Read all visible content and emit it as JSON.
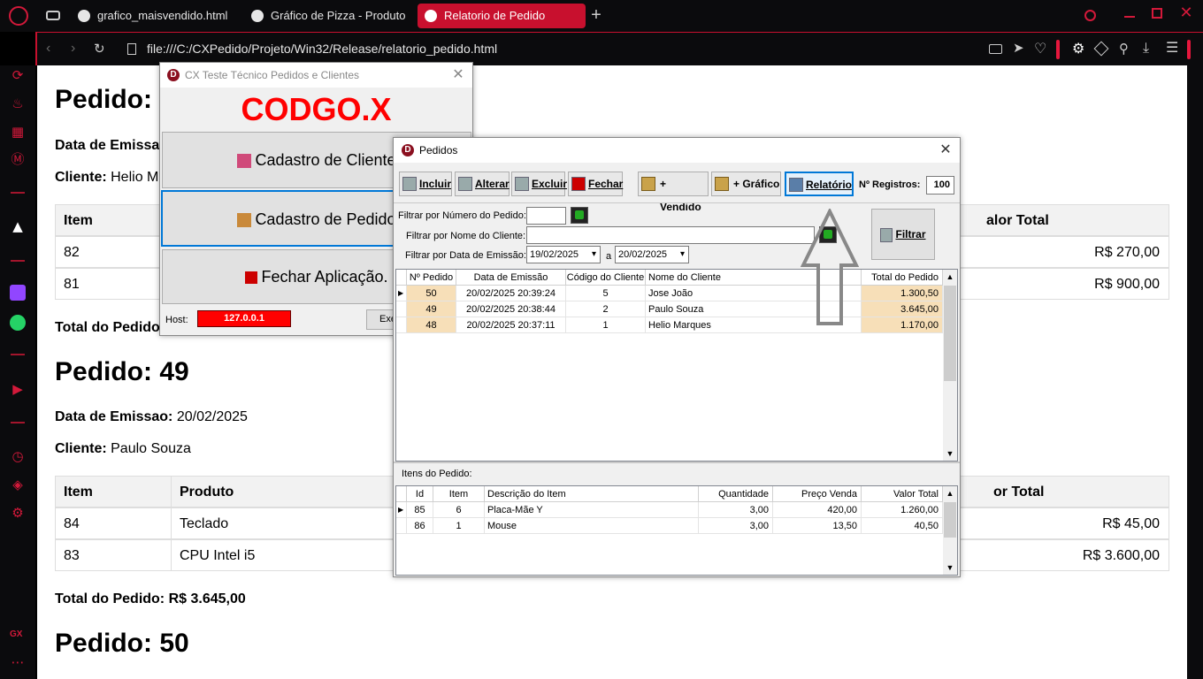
{
  "browser": {
    "tabs": [
      {
        "label": "grafico_maisvendido.html"
      },
      {
        "label": "Gráfico de Pizza - Produto"
      },
      {
        "label": "Relatorio de Pedido"
      }
    ],
    "url": "file:///C:/CXPedido/Projeto/Win32/Release/relatorio_pedido.html",
    "accent": "#c8102e",
    "sidebar_footer": "GX"
  },
  "report": {
    "order1": {
      "title": "Pedido:",
      "date_label": "Data de Emissa",
      "client_label": "Cliente:",
      "client_value": "Helio Ma",
      "col_item": "Item",
      "col_total_partial": "alor Total",
      "rows": [
        {
          "item": "82",
          "total": "R$ 270,00"
        },
        {
          "item": "81",
          "total": "R$ 900,00"
        }
      ],
      "total_label": "Total do Pedido"
    },
    "order2": {
      "title": "Pedido: 49",
      "date_label": "Data de Emissao:",
      "date_value": "20/02/2025",
      "client_label": "Cliente:",
      "client_value": "Paulo Souza",
      "col_item": "Item",
      "col_produto": "Produto",
      "col_total_partial": "or Total",
      "rows": [
        {
          "item": "84",
          "produto": "Teclado",
          "total": "R$ 45,00"
        },
        {
          "item": "83",
          "produto": "CPU Intel i5",
          "total": "R$ 3.600,00"
        }
      ],
      "total_label": "Total do Pedido:",
      "total_value": "R$ 3.645,00"
    },
    "order3": {
      "title": "Pedido: 50"
    }
  },
  "main_window": {
    "title": "CX Teste Técnico Pedidos e Clientes",
    "logo_text": "CODGO.X",
    "btn_clientes": "Cadastro de Cliente",
    "btn_pedidos": "Cadastro de Pedido",
    "btn_fechar": "Fechar Aplicação.",
    "host_label": "Host:",
    "host_value": "127.0.0.1",
    "btn_partial": "Exe"
  },
  "pedidos_window": {
    "title": "Pedidos",
    "toolbar": {
      "incluir": "Incluir",
      "alterar": "Alterar",
      "excluir": "Excluir",
      "fechar": "Fechar",
      "vendido": "+ Vendido",
      "grafico": "+ Gráfico",
      "relatorio": "Relatório",
      "registros_label": "Nº Registros:",
      "registros_value": "100"
    },
    "filters": {
      "numero_label": "Filtrar por Número do Pedido:",
      "numero_value": "",
      "nome_label": "Filtrar por Nome do Cliente:",
      "nome_value": "",
      "data_label": "Filtrar por Data de Emissão:",
      "data_de": "19/02/2025",
      "data_sep": "a",
      "data_ate": "20/02/2025",
      "filtrar_btn": "Filtrar"
    },
    "orders_grid": {
      "headers": [
        "Nº Pedido",
        "Data de Emissão",
        "Código do Cliente",
        "Nome do Cliente",
        "Total do Pedido"
      ],
      "rows": [
        [
          "50",
          "20/02/2025 20:39:24",
          "5",
          "Jose João",
          "1.300,50"
        ],
        [
          "49",
          "20/02/2025 20:38:44",
          "2",
          "Paulo Souza",
          "3.645,00"
        ],
        [
          "48",
          "20/02/2025 20:37:11",
          "1",
          "Helio Marques",
          "1.170,00"
        ]
      ]
    },
    "itens_label": "Itens do Pedido:",
    "items_grid": {
      "headers": [
        "Id",
        "Item",
        "Descrição do Item",
        "Quantidade",
        "Preço Venda",
        "Valor Total"
      ],
      "rows": [
        [
          "85",
          "6",
          "Placa-Mãe Y",
          "3,00",
          "420,00",
          "1.260,00"
        ],
        [
          "86",
          "1",
          "Mouse",
          "3,00",
          "13,50",
          "40,50"
        ]
      ]
    }
  }
}
